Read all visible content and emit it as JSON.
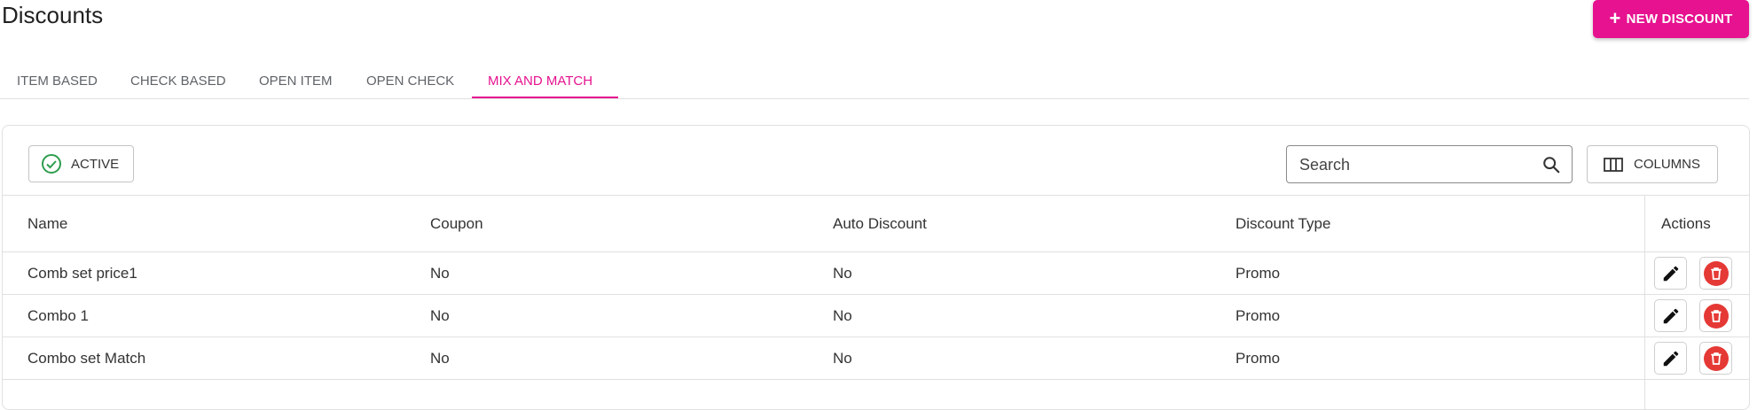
{
  "page": {
    "title": "Discounts"
  },
  "header": {
    "new_button_label": "NEW DISCOUNT",
    "accent_color": "#e6128f"
  },
  "tabs": [
    {
      "label": "ITEM BASED",
      "active": false
    },
    {
      "label": "CHECK BASED",
      "active": false
    },
    {
      "label": "OPEN ITEM",
      "active": false
    },
    {
      "label": "OPEN CHECK",
      "active": false
    },
    {
      "label": "MIX AND MATCH",
      "active": true
    }
  ],
  "toolbar": {
    "filter_label": "ACTIVE",
    "filter_icon": "check-circle-icon",
    "filter_icon_color": "#2e9e4f",
    "search_placeholder": "Search",
    "search_value": "",
    "columns_label": "COLUMNS"
  },
  "table": {
    "columns": [
      "Name",
      "Coupon",
      "Auto Discount",
      "Discount Type",
      "Actions"
    ],
    "rows": [
      {
        "name": "Comb set price1",
        "coupon": "No",
        "auto_discount": "No",
        "discount_type": "Promo"
      },
      {
        "name": "Combo 1",
        "coupon": "No",
        "auto_discount": "No",
        "discount_type": "Promo"
      },
      {
        "name": "Combo set Match",
        "coupon": "No",
        "auto_discount": "No",
        "discount_type": "Promo"
      }
    ],
    "row_actions": {
      "edit_icon": "pencil-icon",
      "delete_icon": "trash-icon",
      "delete_color": "#e53935"
    }
  }
}
